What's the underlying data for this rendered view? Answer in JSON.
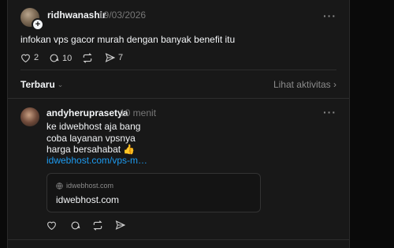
{
  "post": {
    "username": "ridhwanashir",
    "date": "19/03/2026",
    "text": "infokan vps gacor murah dengan banyak benefit itu",
    "more_label": "···",
    "plus_label": "+",
    "likes": "2",
    "comments": "10",
    "shares": "7"
  },
  "sort": {
    "label": "Terbaru",
    "chevron": "⌄",
    "activity": "Lihat aktivitas ›"
  },
  "reply": {
    "username": "andyheruprasetya",
    "time": "10 menit",
    "more_label": "···",
    "lines": [
      "ke idwebhost aja bang",
      "coba layanan vpsnya",
      "harga bersahabat 👍"
    ],
    "link": "idwebhost.com/vps-m…",
    "card": {
      "domain": "idwebhost.com",
      "title": "idwebhost.com"
    }
  }
}
